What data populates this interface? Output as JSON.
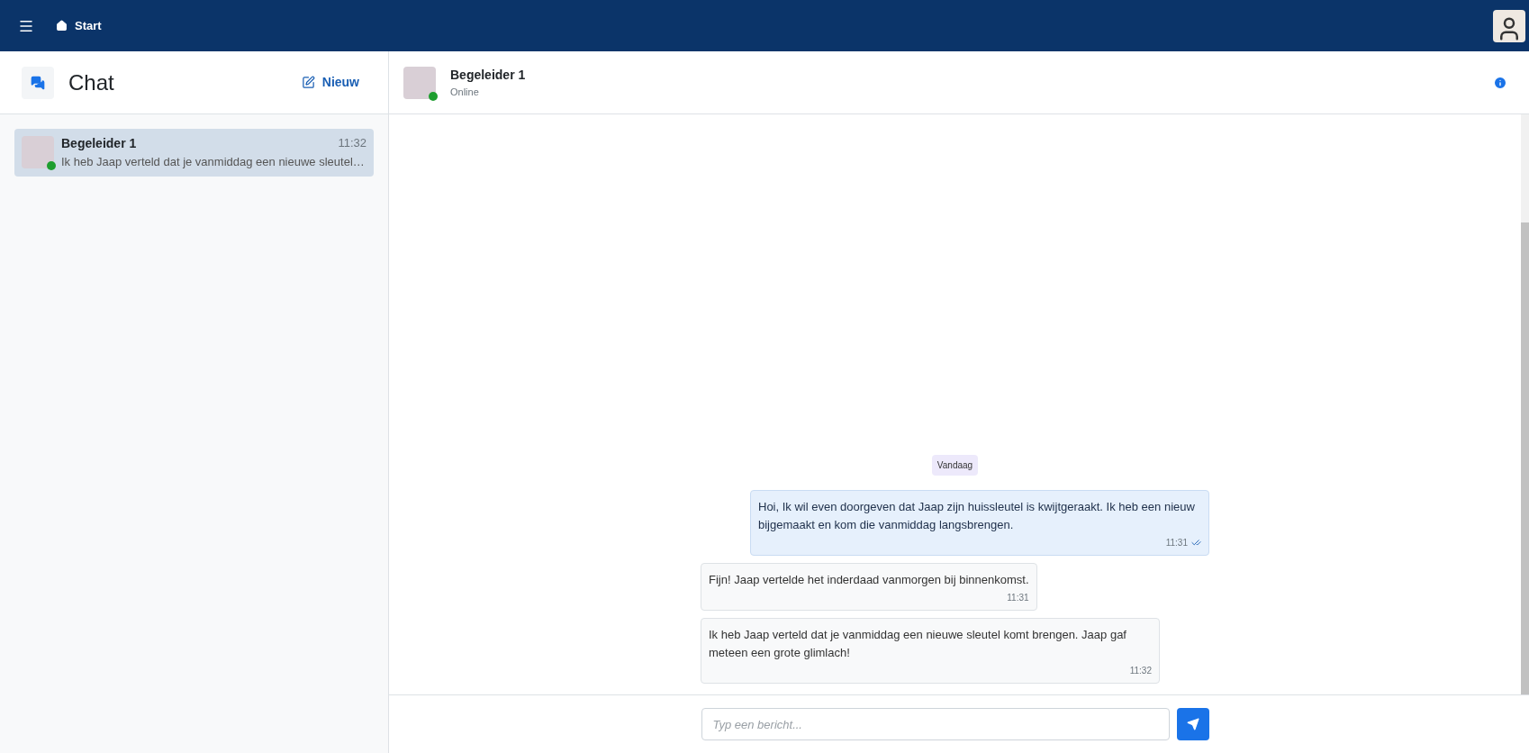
{
  "top_bar": {
    "home_label": "Start"
  },
  "sidebar": {
    "title": "Chat",
    "new_button": "Nieuw",
    "conversations": [
      {
        "name": "Begeleider 1",
        "time": "11:32",
        "preview": "Ik heb Jaap verteld dat je vanmiddag een nieuwe sleutel…",
        "online": true,
        "selected": true
      }
    ]
  },
  "chat": {
    "contact": {
      "name": "Begeleider 1",
      "status": "Online",
      "online": true
    },
    "date_separator": "Vandaag",
    "messages": [
      {
        "kind": "sent",
        "text": "Hoi, Ik wil even doorgeven dat Jaap zijn huissleutel is kwijtgeraakt. Ik heb een nieuw bijgemaakt en kom die vanmiddag langsbrengen.",
        "time": "11:31",
        "read": true
      },
      {
        "kind": "received",
        "text": "Fijn! Jaap vertelde het inderdaad vanmorgen bij binnenkomst.",
        "time": "11:31",
        "read": false
      },
      {
        "kind": "received",
        "text": "Ik heb Jaap verteld dat je vanmiddag een nieuwe sleutel komt brengen. Jaap gaf meteen een grote glimlach!",
        "time": "11:32",
        "read": false
      }
    ],
    "composer": {
      "placeholder": "Typ een bericht..."
    }
  }
}
